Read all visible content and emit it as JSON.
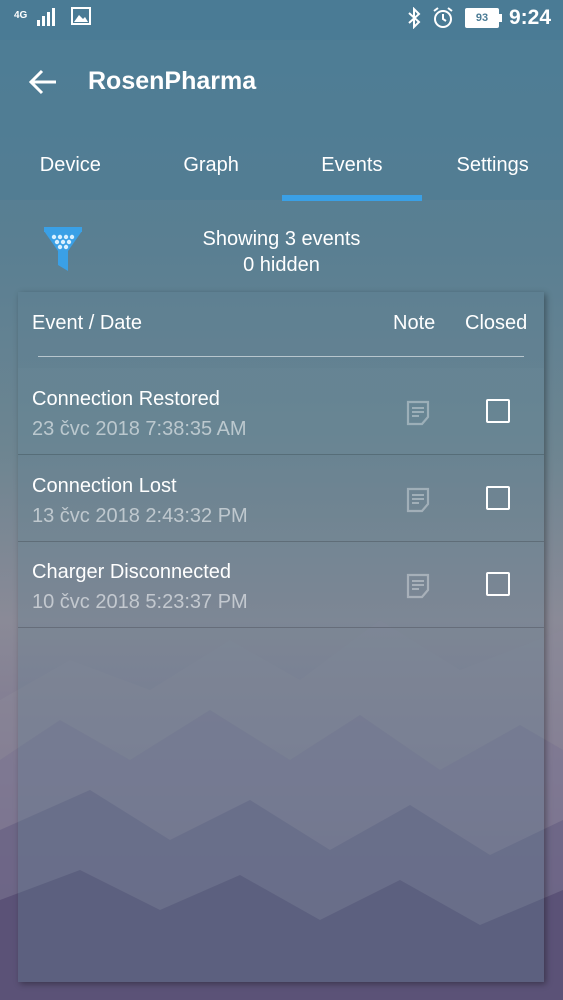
{
  "status_bar": {
    "network": "4G",
    "battery": "93",
    "time": "9:24"
  },
  "app_bar": {
    "title": "RosenPharma",
    "tabs": [
      {
        "label": "Device",
        "active": false
      },
      {
        "label": "Graph",
        "active": false
      },
      {
        "label": "Events",
        "active": true
      },
      {
        "label": "Settings",
        "active": false
      }
    ],
    "accent_color": "#3aa0e6"
  },
  "filter": {
    "showing_text": "Showing 3 events",
    "hidden_text": "0 hidden",
    "icon": "filter-funnel-icon"
  },
  "table": {
    "headers": {
      "event_date": "Event / Date",
      "note": "Note",
      "closed": "Closed"
    },
    "rows": [
      {
        "title": "Connection Restored",
        "date": "23 čvc 2018 7:38:35 AM",
        "closed": false
      },
      {
        "title": "Connection Lost",
        "date": "13 čvc 2018 2:43:32 PM",
        "closed": false
      },
      {
        "title": "Charger Disconnected",
        "date": "10 čvc 2018 5:23:37 PM",
        "closed": false
      }
    ]
  }
}
